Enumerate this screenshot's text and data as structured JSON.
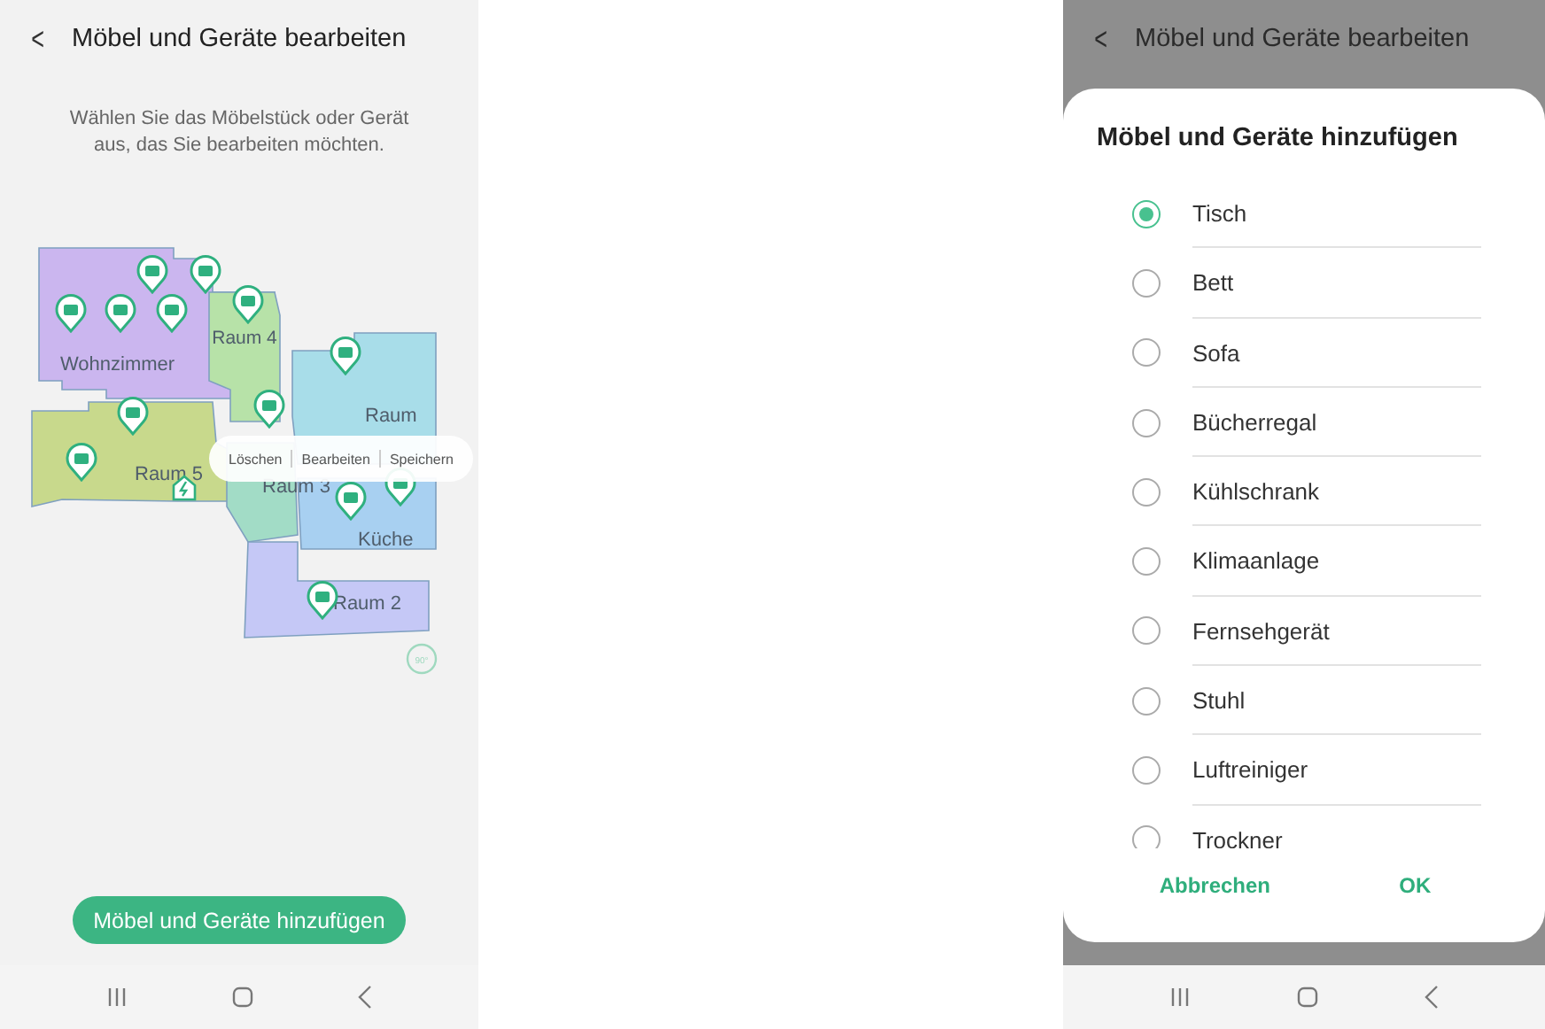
{
  "left_screen": {
    "header": {
      "back": "<",
      "title": "Möbel und Geräte bearbeiten"
    },
    "instruction": "Wählen Sie das Möbelstück oder Gerät aus, das Sie bearbeiten möchten.",
    "map": {
      "rooms": [
        {
          "label": "Wohnzimmer",
          "color": "#cbb6ef"
        },
        {
          "label": "Raum 4",
          "color": "#b7e2a8"
        },
        {
          "label": "Raum",
          "color": "#a8dde9"
        },
        {
          "label": "Raum 5",
          "color": "#c8d98c"
        },
        {
          "label": "Raum 3",
          "color": "#a2dcc6"
        },
        {
          "label": "Küche",
          "color": "#a8d0f1"
        },
        {
          "label": "Raum 2",
          "color": "#c5c8f6"
        }
      ],
      "context_menu": [
        "Löschen",
        "Bearbeiten",
        "Speichern"
      ],
      "rotate_label": "90°"
    },
    "add_button": "Möbel und Geräte hinzufügen"
  },
  "right_screen": {
    "header": {
      "back": "<",
      "title": "Möbel und Geräte bearbeiten"
    },
    "dialog": {
      "title": "Möbel und Geräte hinzufügen",
      "options": [
        {
          "label": "Tisch",
          "selected": true
        },
        {
          "label": "Bett",
          "selected": false
        },
        {
          "label": "Sofa",
          "selected": false
        },
        {
          "label": "Bücherregal",
          "selected": false
        },
        {
          "label": "Kühlschrank",
          "selected": false
        },
        {
          "label": "Klimaanlage",
          "selected": false
        },
        {
          "label": "Fernsehgerät",
          "selected": false
        },
        {
          "label": "Stuhl",
          "selected": false
        },
        {
          "label": "Luftreiniger",
          "selected": false
        },
        {
          "label": "Trockner",
          "selected": false
        }
      ],
      "buttons": [
        "Abbrechen",
        "OK"
      ]
    }
  }
}
